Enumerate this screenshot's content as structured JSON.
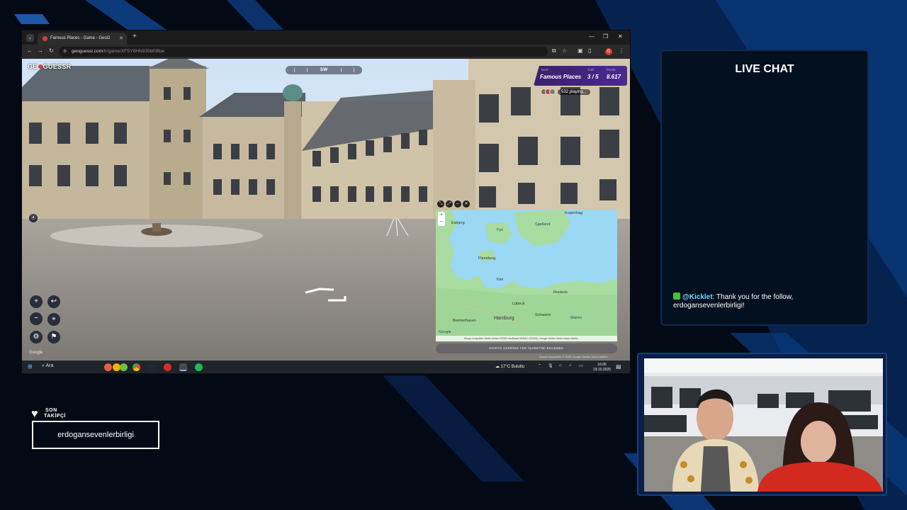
{
  "colors": {
    "background": "#030a16",
    "accent_blue": "#0d3f8a",
    "geoguessr_panel": "#4b2a8c",
    "chat_user": "#7fd4ff",
    "chat_badge": "#3ec43e"
  },
  "browser": {
    "tab_title": "Famous Places - Game - GeoG",
    "url_domain": "geoguessr.com",
    "url_path": "/tr/game/XFSY8HN935bf0Bbe",
    "profile_initial": "G"
  },
  "game": {
    "logo_left": "GE",
    "logo_right": "GUESSR",
    "compass_heading": "SW",
    "map_label": "MAP",
    "map_value": "Famous Places",
    "round_label": "TUR",
    "round_value": "3 / 5",
    "score_label": "PUAN",
    "score_value": "8.617",
    "players_text": "532 playing...",
    "google_mark": "Google",
    "guess_button": "HARİTA ÜZERİNE YER İŞARETİNİ EKLEMEK",
    "page_footer": "Klavye kısayolları  © 2025 Google  Şartlar  Sorun bildirin",
    "map_footer": "Klavye kısayolları   Harita verileri ©2025 GeoBasis-DE/BKG (©2009), Google   Şartlar   Harita hatası bildirin",
    "map_labels": {
      "kopenhag": "Kopenhag",
      "esbjerg": "Esbjerg",
      "fyn": "Fyn",
      "sjaelland": "Sjælland",
      "flensburg": "Flensburg",
      "kiel": "Kiel",
      "rostock": "Rostock",
      "lubeck": "Lübeck",
      "schwerin": "Schwerin",
      "hamburg": "Hamburg",
      "bremerhaven": "Bremerhaven",
      "waren": "Waren",
      "google": "Google"
    }
  },
  "taskbar": {
    "search_label": "Ara",
    "weather": "17°C  Bulutlu",
    "time": "16:05",
    "date": "19.10.2025"
  },
  "chat": {
    "title": "LIVE CHAT",
    "message_user": "@Kicklet",
    "message_text": ": Thank you for the follow, erdogansevenlerbirligi!"
  },
  "follower": {
    "label_line1": "SON",
    "label_line2": "TAKİPÇİ",
    "name": "erdogansevenlerbirligi"
  }
}
